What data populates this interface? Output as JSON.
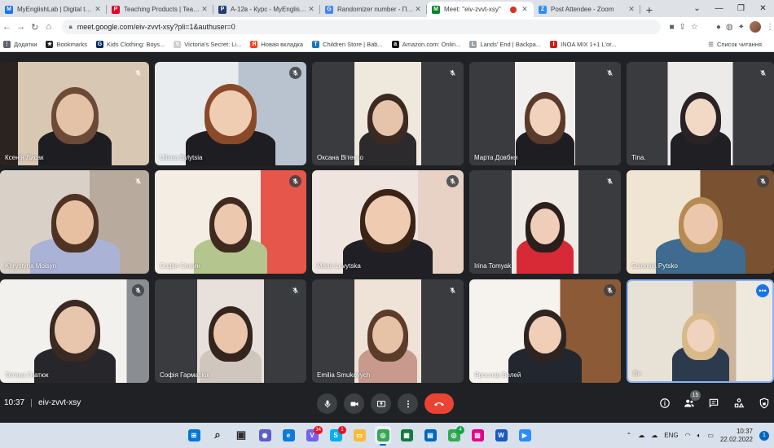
{
  "browser": {
    "tabs": [
      {
        "title": "MyEnglishLab | Digital tools",
        "favicon": "myenglishlab-icon",
        "color": "#1a73e8",
        "glyph": "M"
      },
      {
        "title": "Teaching Products | Teach |",
        "favicon": "pinterest-icon",
        "color": "#e60023",
        "glyph": "P"
      },
      {
        "title": "А-12в - Курс - MyEnglishLab",
        "favicon": "pearson-icon",
        "color": "#1d3f73",
        "glyph": "P"
      },
      {
        "title": "Randomizer number - Пошук",
        "favicon": "google-icon",
        "color": "#4285f4",
        "glyph": "G"
      },
      {
        "title": "Meet: \"eiv-zvvt-xsy\"",
        "favicon": "meet-icon",
        "color": "#00832d",
        "glyph": "M",
        "active": true
      },
      {
        "title": "Post Attendee - Zoom",
        "favicon": "zoom-icon",
        "color": "#2d8cff",
        "glyph": "Z"
      }
    ],
    "new_tab_label": "+",
    "url": "meet.google.com/eiv-zvvt-xsy?pli=1&authuser=0",
    "bookmarks": [
      {
        "label": "Додатки",
        "icon": "apps-icon",
        "color": "#5f6368",
        "glyph": "⋮"
      },
      {
        "label": "Bookmarks",
        "icon": "star-icon",
        "color": "#202124",
        "glyph": "★"
      },
      {
        "label": "Kids Clothing: Boys...",
        "icon": "gap-icon",
        "color": "#002a5c",
        "glyph": "G"
      },
      {
        "label": "Victoria's Secret: Li...",
        "icon": "vs-icon",
        "color": "#cfcfcf",
        "glyph": "V"
      },
      {
        "label": "Новая вкладка",
        "icon": "yandex-icon",
        "color": "#fc3f1d",
        "glyph": "Я"
      },
      {
        "label": "Children Store | Bab...",
        "icon": "tcp-icon",
        "color": "#1b75bb",
        "glyph": "T"
      },
      {
        "label": "Amazon.com: Onlin...",
        "icon": "amazon-icon",
        "color": "#111111",
        "glyph": "a"
      },
      {
        "label": "Lands' End | Backpa...",
        "icon": "landsend-icon",
        "color": "#9aa0a6",
        "glyph": "L"
      },
      {
        "label": "INOA MIX 1+1 L'or...",
        "icon": "loreal-icon",
        "color": "#c5221f",
        "glyph": "I"
      }
    ],
    "reading_list_label": "Список читання"
  },
  "meet": {
    "participants": [
      {
        "name": "Ксенія Лисак",
        "mic": "muted"
      },
      {
        "name": "Uliana Bylytsia",
        "mic": "muted"
      },
      {
        "name": "Оксана Вітенко",
        "mic": "muted"
      },
      {
        "name": "Марта Довбня",
        "mic": "muted"
      },
      {
        "name": "Tina.",
        "mic": "muted"
      },
      {
        "name": "Khrystyna Moisyn",
        "mic": "muted"
      },
      {
        "name": "Софія Семин",
        "mic": "muted"
      },
      {
        "name": "Maria Levytska",
        "mic": "muted"
      },
      {
        "name": "Irina Tomyak",
        "mic": "muted"
      },
      {
        "name": "Solomiia Pytsko",
        "mic": "muted"
      },
      {
        "name": "Тетяна Гнатюк",
        "mic": "muted"
      },
      {
        "name": "Софія Гарматюк",
        "mic": "muted"
      },
      {
        "name": "Emilia Smukovych",
        "mic": "muted"
      },
      {
        "name": "Ярослав Белей",
        "mic": "muted"
      },
      {
        "name": "Ви",
        "mic": "self"
      }
    ],
    "time": "10:37",
    "meeting_code": "eiv-zvvt-xsy",
    "participant_count": "15"
  },
  "taskbar": {
    "apps": [
      {
        "name": "start-icon",
        "color": "#0078d4",
        "glyph": "⊞",
        "count": ""
      },
      {
        "name": "search-icon",
        "color": "#1f1f1f",
        "glyph": "⌕",
        "count": ""
      },
      {
        "name": "task-view-icon",
        "color": "#2b2b2b",
        "glyph": "▣",
        "count": ""
      },
      {
        "name": "chat-icon",
        "color": "#5b5fc7",
        "glyph": "◉",
        "count": ""
      },
      {
        "name": "edge-icon",
        "color": "#0c7bd8",
        "glyph": "e",
        "count": ""
      },
      {
        "name": "viber-icon",
        "color": "#7360f2",
        "glyph": "V",
        "count": "34"
      },
      {
        "name": "skype-icon",
        "color": "#00aff0",
        "glyph": "S",
        "count": "1"
      },
      {
        "name": "file-explorer-icon",
        "color": "#f6bd3a",
        "glyph": "▭",
        "count": ""
      },
      {
        "name": "chrome-icon",
        "color": "#34a853",
        "glyph": "◎",
        "count": "",
        "active": true
      },
      {
        "name": "spreadsheet-icon",
        "color": "#107c41",
        "glyph": "▦",
        "count": ""
      },
      {
        "name": "store-icon",
        "color": "#0067c0",
        "glyph": "▤",
        "count": ""
      },
      {
        "name": "chrome-profile-icon",
        "color": "#34a853",
        "glyph": "◎",
        "count": "4"
      },
      {
        "name": "photos-icon",
        "color": "#e3008c",
        "glyph": "▧",
        "count": ""
      },
      {
        "name": "word-icon",
        "color": "#185abd",
        "glyph": "W",
        "count": ""
      },
      {
        "name": "zoom-icon",
        "color": "#2d8cff",
        "glyph": "▶",
        "count": ""
      }
    ],
    "language": "ENG",
    "clock_time": "10:37",
    "clock_date": "22.02.2022"
  }
}
